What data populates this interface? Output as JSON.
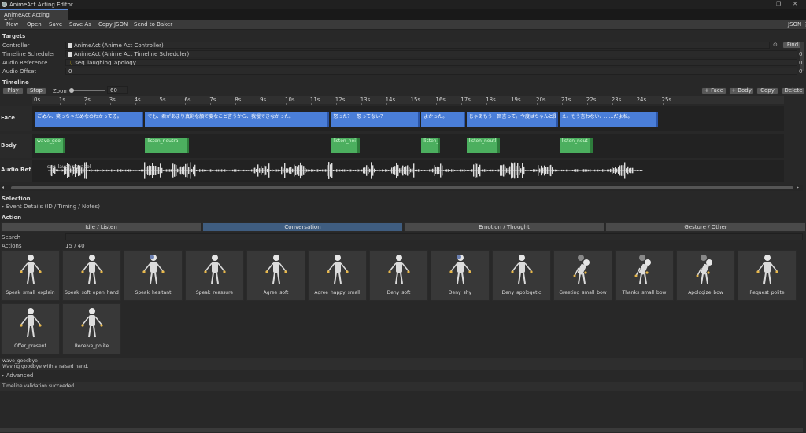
{
  "window": {
    "title": "AnimeAct Acting Editor",
    "tab": "AnimeAct Acting Editor",
    "more_label": "JSON",
    "more_icon": "kebab-menu-icon"
  },
  "toolbar": {
    "new": "New",
    "open": "Open",
    "save": "Save",
    "save_as": "Save As",
    "copy_json": "Copy JSON",
    "send": "Send to Baker"
  },
  "targets": {
    "header": "Targets",
    "controller_label": "Controller",
    "controller_value": "AnimeAct (Anime Act Controller)",
    "find": "Find",
    "scheduler_label": "Timeline Scheduler",
    "scheduler_value": "AnimeAct (Anime Act Timeline Scheduler)",
    "audio_label": "Audio Reference",
    "audio_value": "seq_laughing_apology",
    "offset_label": "Audio Offset",
    "offset_value": "0",
    "side_zero": "0"
  },
  "timeline": {
    "header": "Timeline",
    "play": "Play",
    "stop": "Stop",
    "zoom_label": "Zoom",
    "zoom_value": "60",
    "zoom_level": 0.0,
    "add_face": "+ Face",
    "add_body": "+ Body",
    "copy": "Copy",
    "delete": "Delete",
    "ticks": [
      "0s",
      "1s",
      "2s",
      "3s",
      "4s",
      "5s",
      "6s",
      "7s",
      "8s",
      "9s",
      "10s",
      "11s",
      "12s",
      "13s",
      "14s",
      "15s",
      "16s",
      "17s",
      "18s",
      "19s",
      "20s",
      "21s",
      "22s",
      "23s",
      "24s",
      "25s"
    ],
    "tracks": {
      "face": "Face",
      "body": "Body",
      "audio": "Audio Ref"
    },
    "face_clips": [
      {
        "text": "ごめん、笑っちゃだめなのわかってる。",
        "start": 0.0,
        "end": 4.4
      },
      {
        "text": "でも、君があまり真剣な顔で変なこと言うから、我慢できなかった。",
        "start": 4.4,
        "end": 11.8
      },
      {
        "text": "怒った？　怒ってない？",
        "start": 11.8,
        "end": 15.4
      },
      {
        "text": "よかった。",
        "start": 15.4,
        "end": 17.2
      },
      {
        "text": "じゃあもう一回言って。今度はちゃんと聞く。",
        "start": 17.2,
        "end": 20.9
      },
      {
        "text": "え、もう言わない、……だよね。",
        "start": 20.9,
        "end": 24.9
      }
    ],
    "body_clips": [
      {
        "text": "wave_goo",
        "start": 0.0,
        "end": 1.3
      },
      {
        "text": "listen_neutral",
        "start": 4.4,
        "end": 6.2
      },
      {
        "text": "listen_nei",
        "start": 11.8,
        "end": 13.0
      },
      {
        "text": "listen_",
        "start": 15.4,
        "end": 16.2
      },
      {
        "text": "listen_neutl",
        "start": 17.2,
        "end": 18.6
      },
      {
        "text": "listen_neut",
        "start": 20.9,
        "end": 22.3
      }
    ],
    "audio_clip_label": "seq_laughing_apol",
    "audio_end": 24.2
  },
  "selection": {
    "header": "Selection",
    "details": "Event Details (ID / Timing / Notes)"
  },
  "action": {
    "header": "Action",
    "categories": [
      "Idle / Listen",
      "Conversation",
      "Emotion / Thought",
      "Gesture / Other"
    ],
    "active_category": 1,
    "search_label": "Search",
    "actions_label": "Actions",
    "count": "15 / 40",
    "cards": [
      "Speak_small_explain",
      "Speak_soft_open_hand",
      "Speak_hesitant",
      "Speak_reassure",
      "Agree_soft",
      "Agree_happy_small",
      "Deny_soft",
      "Deny_shy",
      "Deny_apologetic",
      "Greeting_small_bow",
      "Thanks_small_bow",
      "Apologize_bow",
      "Request_polite",
      "Offer_present",
      "Receive_polite"
    ],
    "selected_name": "wave_goodbye",
    "selected_desc": "Waving goodbye with a raised hand.",
    "advanced": "Advanced"
  },
  "status": "Timeline validation succeeded.",
  "colors": {
    "face_clip": "#4a7ed8",
    "body_clip": "#4caf5f",
    "active_tab": "#3f5d80",
    "hand_accent": "#e8b84a"
  }
}
